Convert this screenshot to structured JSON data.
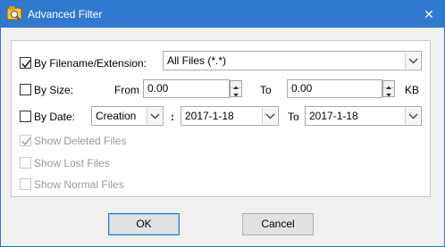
{
  "window": {
    "title": "Advanced Filter",
    "close_glyph": "✕"
  },
  "filename_filter": {
    "label": "By Filename/Extension:",
    "checked": true,
    "selected": "All Files (*.*)"
  },
  "size_filter": {
    "label": "By Size:",
    "checked": false,
    "from_label": "From",
    "from_value": "0.00",
    "to_label": "To",
    "to_value": "0.00",
    "unit": "KB"
  },
  "date_filter": {
    "label": "By Date:",
    "checked": false,
    "type_selected": "Creation",
    "colon": ":",
    "start_date": "2017-1-18",
    "to_label": "To",
    "end_date": "2017-1-18"
  },
  "options": {
    "show_deleted": {
      "label": "Show Deleted Files",
      "checked": true,
      "enabled": false
    },
    "show_lost": {
      "label": "Show Lost Files",
      "checked": false,
      "enabled": false
    },
    "show_normal": {
      "label": "Show Normal Files",
      "checked": false,
      "enabled": false
    }
  },
  "buttons": {
    "ok": "OK",
    "cancel": "Cancel"
  },
  "colors": {
    "titlebar": "#2f7ad0",
    "disabled_text": "#9a9a9a"
  }
}
